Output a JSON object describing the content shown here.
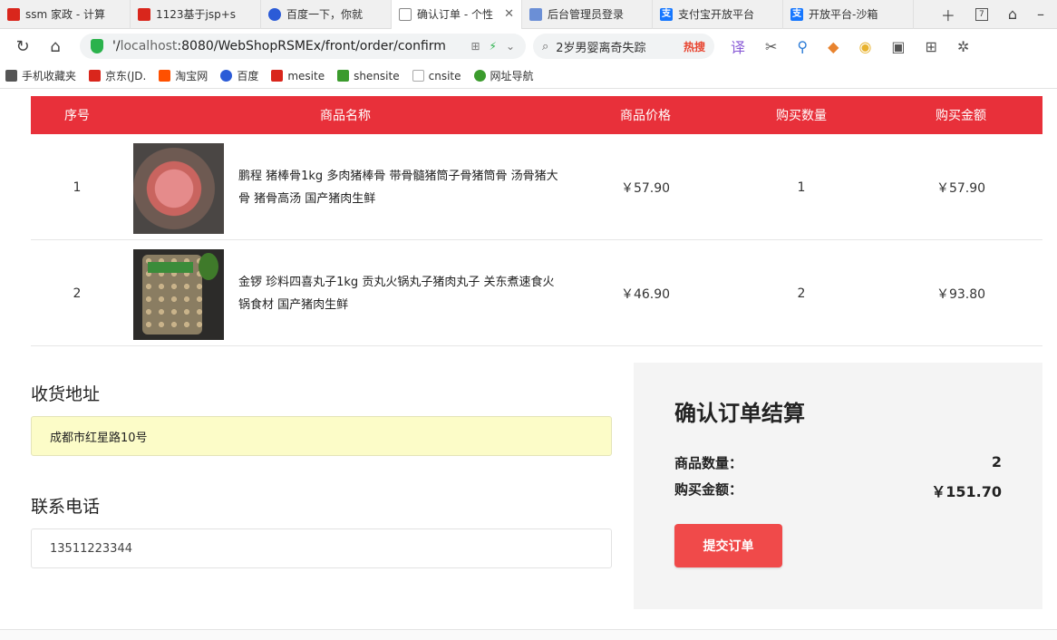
{
  "browser": {
    "tabs": [
      {
        "title": "ssm 家政 - 计算",
        "favicon": "red"
      },
      {
        "title": "1123基于jsp+s",
        "favicon": "red"
      },
      {
        "title": "百度一下，你就",
        "favicon": "paw"
      },
      {
        "title": "确认订单 - 个性",
        "favicon": "doc",
        "active": true
      },
      {
        "title": "后台管理员登录",
        "favicon": "img"
      },
      {
        "title": "支付宝开放平台",
        "favicon": "ali"
      },
      {
        "title": "开放平台-沙箱",
        "favicon": "ali"
      }
    ],
    "url_prefix": "'/",
    "url_host": "localhost",
    "url_rest": ":8080/WebShopRSMEx/front/order/confirm",
    "search_text": "2岁男婴离奇失踪",
    "search_hot": "热搜",
    "bookmarks": [
      {
        "label": "手机收藏夹",
        "color": "#555555"
      },
      {
        "label": "京东(JD.",
        "color": "#d9261c"
      },
      {
        "label": "淘宝网",
        "color": "#ff5000"
      },
      {
        "label": "百度",
        "color": "#2b5bd7"
      },
      {
        "label": "mesite",
        "color": "#d9261c"
      },
      {
        "label": "shensite",
        "color": "#3b9b2d"
      },
      {
        "label": "cnsite",
        "color": "#cccccc"
      },
      {
        "label": "网址导航",
        "color": "#3b9b2d"
      }
    ]
  },
  "table": {
    "headers": {
      "idx": "序号",
      "name": "商品名称",
      "price": "商品价格",
      "qty": "购买数量",
      "amount": "购买金额"
    },
    "rows": [
      {
        "idx": "1",
        "name": "鹏程 猪棒骨1kg 多肉猪棒骨 带骨髓猪筒子骨猪筒骨 汤骨猪大骨 猪骨高汤 国产猪肉生鲜",
        "price": "￥57.90",
        "qty": "1",
        "amount": "￥57.90"
      },
      {
        "idx": "2",
        "name": "金锣 珍料四喜丸子1kg 贡丸火锅丸子猪肉丸子 关东煮速食火锅食材 国产猪肉生鲜",
        "price": "￥46.90",
        "qty": "2",
        "amount": "￥93.80"
      }
    ]
  },
  "address": {
    "label": "收货地址",
    "value": "成都市红星路10号"
  },
  "phone": {
    "label": "联系电话",
    "value": "13511223344"
  },
  "summary": {
    "title": "确认订单结算",
    "count_label": "商品数量：",
    "count_value": "2",
    "amount_label": "购买金额：",
    "amount_value": "￥151.70",
    "submit_label": "提交订单"
  },
  "colors": {
    "header_red": "#e8303a",
    "submit_red": "#f04a4a",
    "address_bg": "#fcfcc8"
  }
}
